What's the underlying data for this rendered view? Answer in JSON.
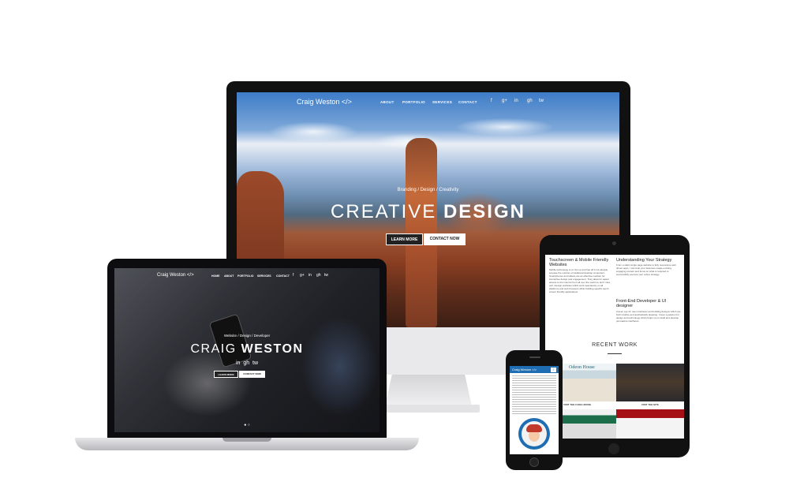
{
  "imac": {
    "logo": "Craig Weston </>",
    "nav": [
      "ABOUT",
      "PORTFOLIO",
      "SERVICES",
      "CONTACT"
    ],
    "tagline": "Branding / Design / Creativity",
    "title_light": "CREATIVE",
    "title_bold": "DESIGN",
    "btn_learn": "LEARN MORE",
    "btn_contact": "CONTACT NOW"
  },
  "macbook": {
    "logo": "Craig Weston </>",
    "nav": [
      "HOME",
      "ABOUT",
      "PORTFOLIO",
      "SERVICES",
      "CONTACT"
    ],
    "tagline": "Website / Design / Developer",
    "title_light": "CRAIG",
    "title_bold": "WESTON",
    "btn_learn": "LEARN MORE",
    "btn_contact": "CONTACT NOW"
  },
  "tablet": {
    "col1_title": "Touchscreen & Mobile Friendly Websites",
    "col1_body": "Mobile technology is on the up and has off it not already surpass the number of traditional desktop computers. Smartphones and tablets are an effective medium for interactive design and engagement. They allow for easier access to the internet from all over the world so don't miss out! I design websites which work seamlessly on all platforms and web browsers while building specific touch screen friendly applications.",
    "col2_title": "Understanding Your Strategy",
    "col2_body": "From a static single page website to fully responsive web driven apps, I can help your business create exciting, engaging content and focus on what is required to successfully execute your online strategy.",
    "col3_title": "Front-End Developer & UI designer",
    "col3_body": "A keen eye for user interfaces and building designs which are both intuitive and aesthetically pleasing. I have a passion for design and technology which helps me to build and develop persuasive interfaces.",
    "recent_work": "RECENT WORK",
    "thumb1_brand": "Odeon House",
    "visit_cake": "VISIT THE CAKE HOUSE",
    "visit_site": "VISIT THE SITE"
  },
  "phone": {
    "logo": "Craig Weston </>",
    "menu_icon": "≡"
  },
  "icons": {
    "apple": "",
    "social": [
      "f",
      "g+",
      "in",
      "gh",
      "tw"
    ]
  }
}
